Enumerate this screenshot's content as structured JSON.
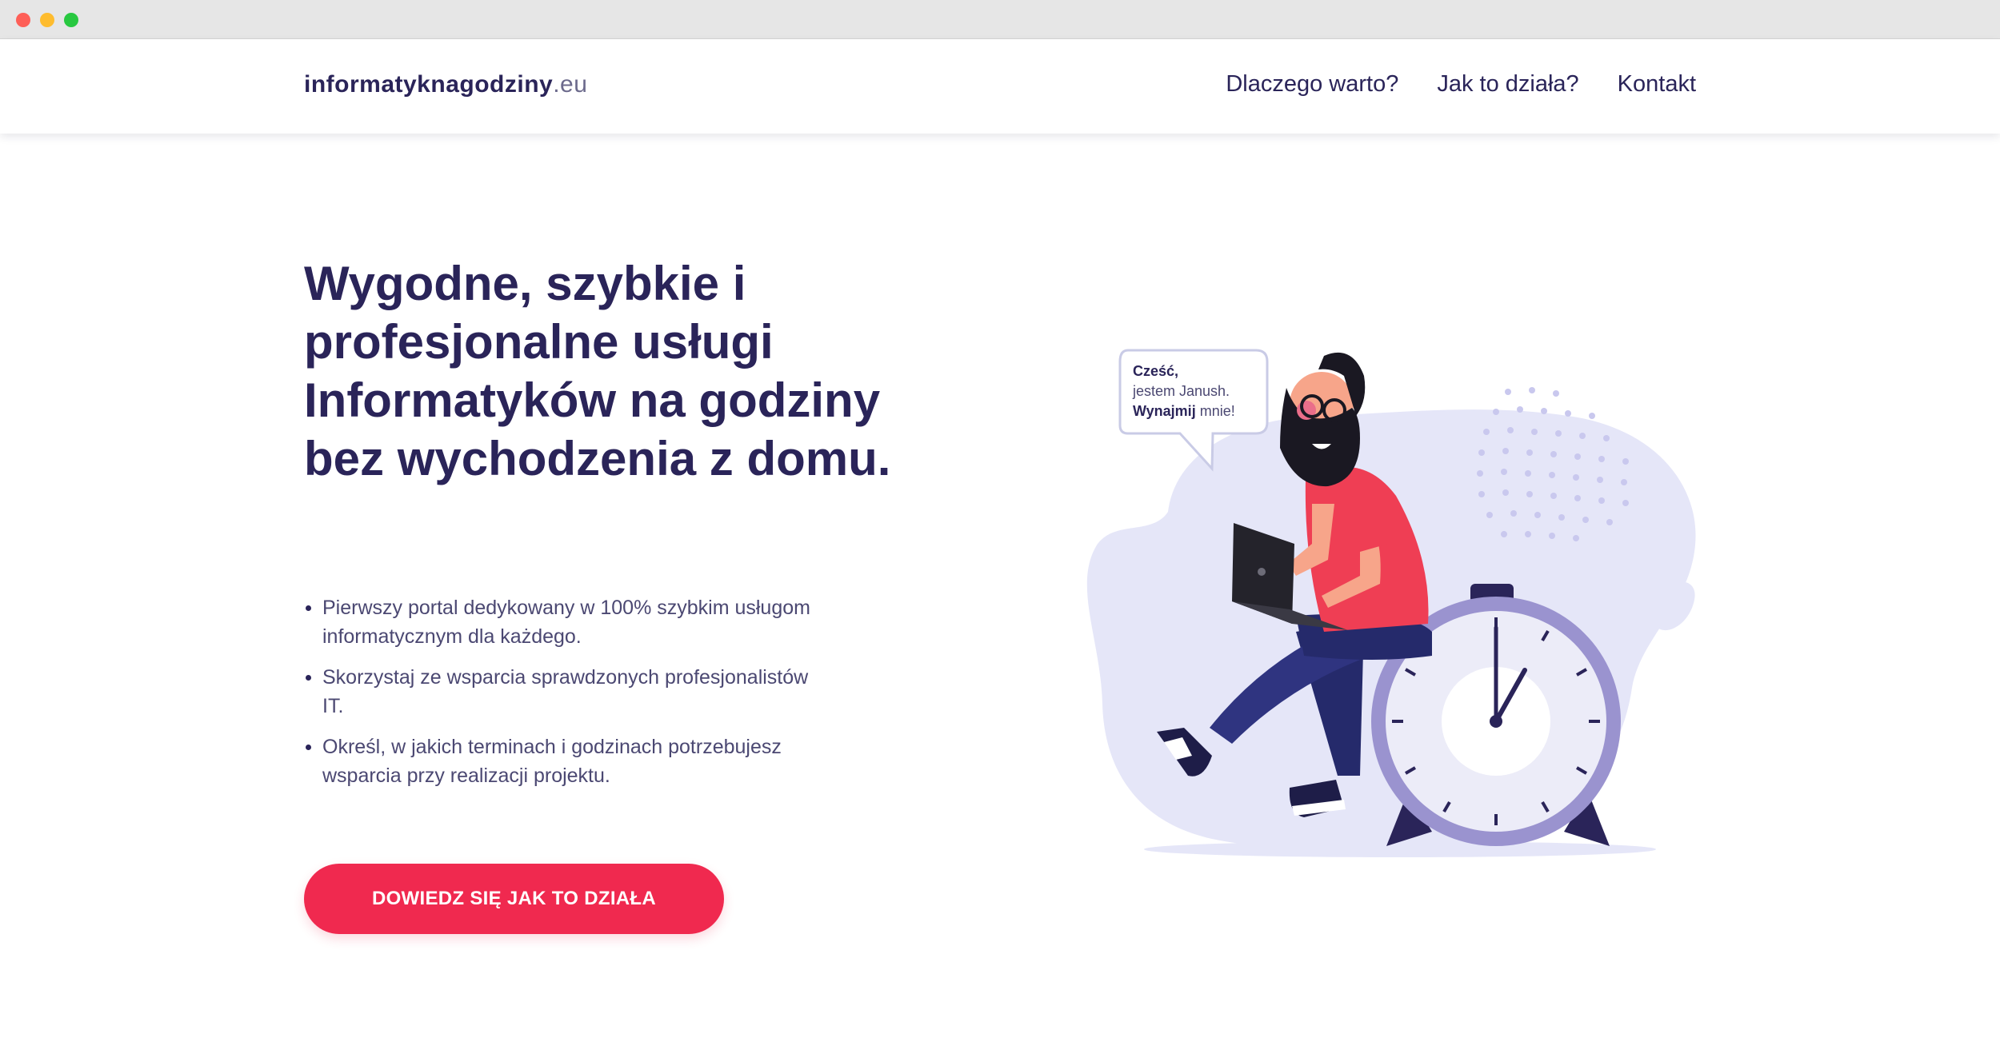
{
  "header": {
    "logo_main": "informatyknagodziny",
    "logo_tld": ".eu",
    "nav": [
      {
        "label": "Dlaczego warto?"
      },
      {
        "label": "Jak to działa?"
      },
      {
        "label": "Kontakt"
      }
    ]
  },
  "hero": {
    "title": "Wygodne, szybkie i profesjonalne usługi Informatyków na godziny bez wychodzenia z domu.",
    "features": [
      "Pierwszy portal dedykowany w 100% szybkim usługom informatycznym dla każdego.",
      "Skorzystaj ze wsparcia sprawdzonych profesjonalistów IT.",
      "Określ, w jakich terminach i godzinach potrzebujesz wsparcia przy realizacji projektu."
    ],
    "cta_label": "DOWIEDZ SIĘ JAK TO DZIAŁA"
  },
  "speech_bubble": {
    "line1": "Cześć,",
    "line2": "jestem Janush.",
    "line3_bold": "Wynajmij",
    "line3_rest": " mnie!"
  },
  "colors": {
    "brand_dark": "#2a2459",
    "accent": "#f0294f",
    "blob": "#e5e6f8",
    "clock": "#9a93cf"
  }
}
